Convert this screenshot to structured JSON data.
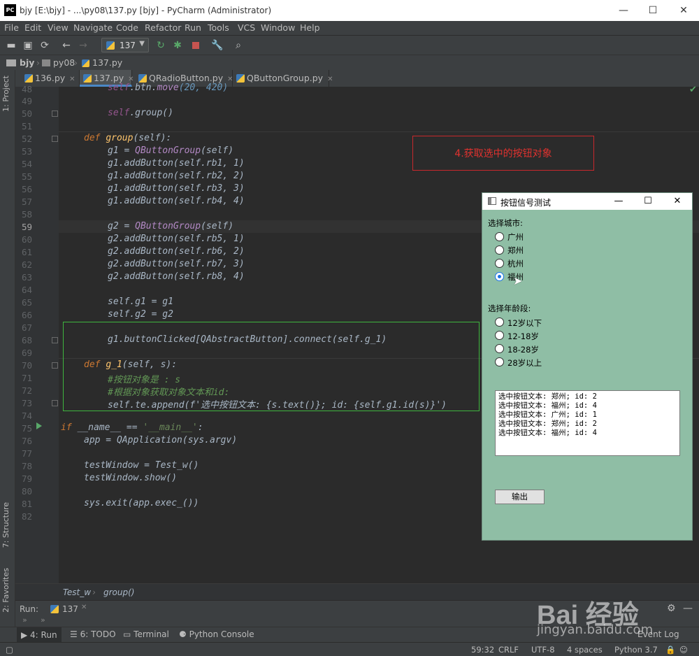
{
  "window": {
    "title": "bjy [E:\\bjy] - ...\\py08\\137.py [bjy] - PyCharm (Administrator)",
    "app_badge": "PC",
    "minimize": "—",
    "maximize": "☐",
    "close": "✕"
  },
  "menu": [
    "File",
    "Edit",
    "View",
    "Navigate",
    "Code",
    "Refactor",
    "Run",
    "Tools",
    "VCS",
    "Window",
    "Help"
  ],
  "toolbar": {
    "run_config": "137"
  },
  "breadcrumbs": [
    "bjy",
    "py08",
    "137.py"
  ],
  "side_tabs": {
    "project": "1: Project",
    "structure": "7: Structure",
    "favorites": "2: Favorites"
  },
  "tabs": [
    {
      "label": "136.py",
      "active": false
    },
    {
      "label": "137.py",
      "active": true
    },
    {
      "label": "QRadioButton.py",
      "active": false
    },
    {
      "label": "QButtonGroup.py",
      "active": false
    }
  ],
  "line_numbers": [
    "48",
    "49",
    "50",
    "51",
    "52",
    "53",
    "54",
    "55",
    "56",
    "57",
    "58",
    "59",
    "60",
    "61",
    "62",
    "63",
    "64",
    "65",
    "66",
    "67",
    "68",
    "69",
    "70",
    "71",
    "72",
    "73",
    "74",
    "75",
    "76",
    "77",
    "78",
    "79",
    "80",
    "81",
    "82"
  ],
  "code": {
    "l48_a": "self",
    "l48_b": ".btn.",
    "l48_c": "move",
    "l48_d": "(20, 420)",
    "l50_a": "self",
    "l50_b": ".group()",
    "l52_def": "def ",
    "l52_fn": "group",
    "l52_args": "(self):",
    "l53": "g1 = ",
    "l53_cls": "QButtonGroup",
    "l53_arg": "(self)",
    "g1_lines": [
      "g1.addButton(self.rb1, 1)",
      "g1.addButton(self.rb2, 2)",
      "g1.addButton(self.rb3, 3)",
      "g1.addButton(self.rb4, 4)"
    ],
    "l59": "g2 = ",
    "l59_cls": "QButtonGroup",
    "l59_arg": "(self)",
    "g2_lines": [
      "g2.addButton(self.rb5, 1)",
      "g2.addButton(self.rb6, 2)",
      "g2.addButton(self.rb7, 3)",
      "g2.addButton(self.rb8, 4)"
    ],
    "l65": "self.g1 = g1",
    "l66": "self.g2 = g2",
    "l68": "g1.buttonClicked[QAbstractButton].connect(self.g_1)",
    "l70_def": "def ",
    "l70_fn": "g_1",
    "l70_args": "(self, s):",
    "l71": "#按钮对象是 : s",
    "l72": "#根据对象获取对象文本和id:",
    "l73": "self.te.append(f'选中按钮文本: {s.text()}; id: {self.g1.id(s)}')",
    "l75_if": "if ",
    "l75_rest": "__name__ == ",
    "l75_str": "'__main__'",
    "l75_colon": ":",
    "l76": "app = QApplication(sys.argv)",
    "l78": "testWindow = Test_w()",
    "l79": "testWindow.show()",
    "l81": "sys.exit(app.exec_())"
  },
  "annotation": "4.获取选中的按钮对象",
  "editor_breadcrumb": [
    "Test_w",
    "group()"
  ],
  "run_panel": {
    "label": "Run:",
    "config": "137"
  },
  "bottom_tabs": [
    "4: Run",
    "6: TODO",
    "Terminal",
    "Python Console"
  ],
  "status": {
    "position": "59:32",
    "line_sep": "CRLF",
    "encoding": "UTF-8",
    "indent": "4 spaces",
    "interpreter": "Python 3.7",
    "event_log": "Event Log"
  },
  "qt_window": {
    "title": "按钮信号测试",
    "city_label": "选择城市:",
    "cities": [
      {
        "label": "广州",
        "checked": false
      },
      {
        "label": "郑州",
        "checked": false
      },
      {
        "label": "杭州",
        "checked": false
      },
      {
        "label": "福州",
        "checked": true
      }
    ],
    "age_label": "选择年龄段:",
    "ages": [
      {
        "label": "12岁以下",
        "checked": false
      },
      {
        "label": "12-18岁",
        "checked": false
      },
      {
        "label": "18-28岁",
        "checked": false
      },
      {
        "label": "28岁以上",
        "checked": false
      }
    ],
    "output_lines": [
      "选中按钮文本: 郑州; id: 2",
      "选中按钮文本: 福州; id: 4",
      "选中按钮文本: 广州; id: 1",
      "选中按钮文本: 郑州; id: 2",
      "选中按钮文本: 福州; id: 4"
    ],
    "button": "输出"
  },
  "watermark": {
    "brand": "Bai  经验",
    "url": "jingyan.baidu.com"
  }
}
